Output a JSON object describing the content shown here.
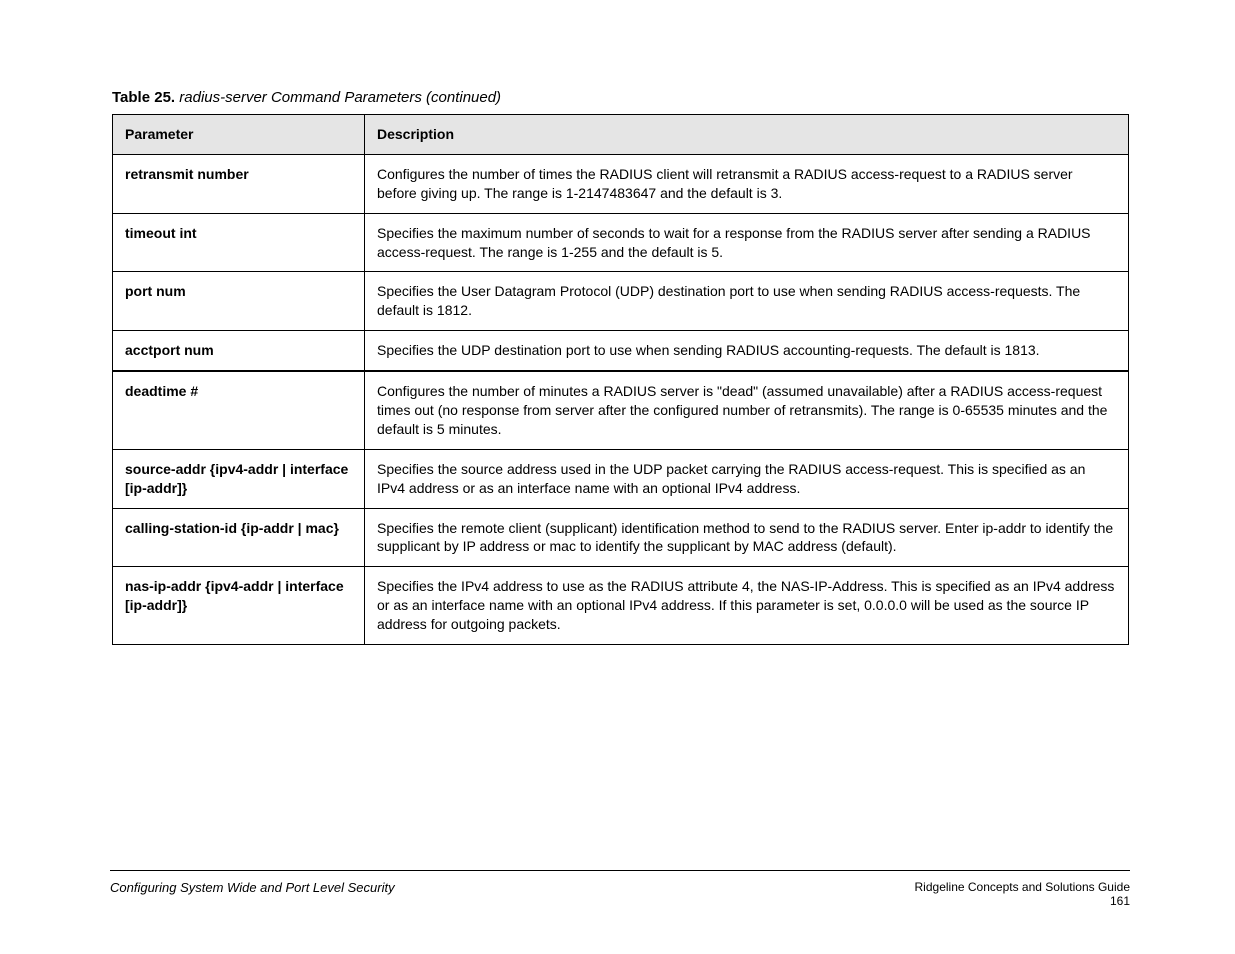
{
  "title": {
    "prefix": "Table 25.",
    "text": "radius-server Command Parameters (continued)"
  },
  "table": {
    "headers": [
      "Parameter",
      "Description"
    ],
    "rows": [
      {
        "param": "retransmit number",
        "desc": "Configures the number of times the RADIUS client will retransmit a RADIUS access-request to a RADIUS server before giving up. The range is 1-2147483647 and the default is 3."
      },
      {
        "param": "timeout int",
        "desc": "Specifies the maximum number of seconds to wait for a response from the RADIUS server after sending a RADIUS access-request. The range is 1-255 and the default is 5."
      },
      {
        "param": "port num",
        "desc": "Specifies the User Datagram Protocol (UDP) destination port to use when sending RADIUS access-requests. The default is 1812."
      },
      {
        "param": "acctport num",
        "desc": "Specifies the UDP destination port to use when sending RADIUS accounting-requests. The default is 1813."
      },
      {
        "param": "deadtime #",
        "desc": "Configures the number of minutes a RADIUS server is \"dead\" (assumed unavailable) after a RADIUS access-request times out (no response from server after the configured number of retransmits). The range is 0-65535 minutes and the default is 5 minutes."
      },
      {
        "param": "source-addr {ipv4-addr | interface [ip-addr]}",
        "desc": "Specifies the source address used in the UDP packet carrying the RADIUS access-request. This is specified as an IPv4 address or as an interface name with an optional IPv4 address."
      },
      {
        "param": "calling-station-id {ip-addr | mac}",
        "desc": "Specifies the remote client (supplicant) identification method to send to the RADIUS server. Enter ip-addr to identify the supplicant by IP address or mac to identify the supplicant by MAC address (default)."
      },
      {
        "param": "nas-ip-addr {ipv4-addr | interface [ip-addr]}",
        "desc": "Specifies the IPv4 address to use as the RADIUS attribute 4, the NAS-IP-Address. This is specified as an IPv4 address or as an interface name with an optional IPv4 address. If this parameter is set, 0.0.0.0 will be used as the source IP address for outgoing packets."
      }
    ],
    "section_break_before_index": 4
  },
  "footer": {
    "left": "Configuring System Wide and Port Level Security",
    "right_line1": "Ridgeline Concepts and Solutions Guide",
    "right_line2": "161"
  }
}
